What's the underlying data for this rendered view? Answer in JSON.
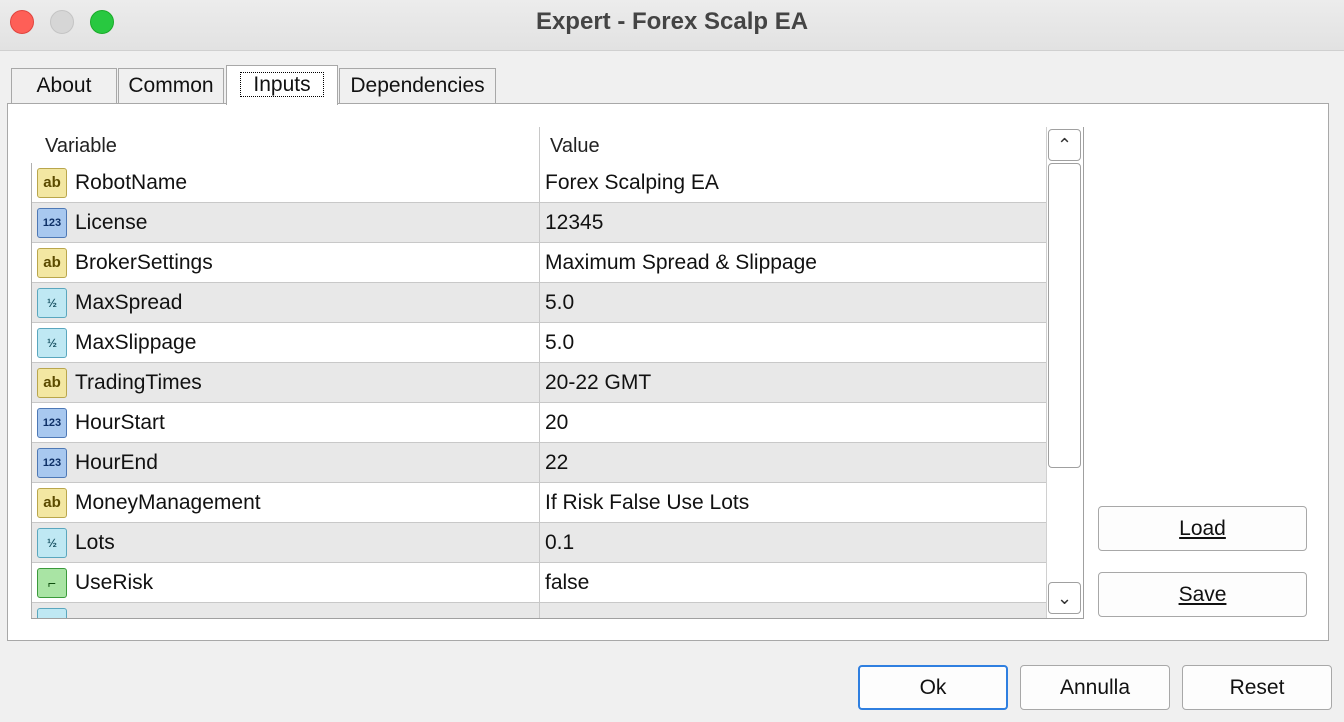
{
  "window": {
    "title": "Expert - Forex Scalp EA"
  },
  "tabs": [
    {
      "label": "About"
    },
    {
      "label": "Common"
    },
    {
      "label": "Inputs"
    },
    {
      "label": "Dependencies"
    }
  ],
  "grid": {
    "headers": {
      "variable": "Variable",
      "value": "Value"
    },
    "rows": [
      {
        "type": "string",
        "icon_text": "ab",
        "variable": "RobotName",
        "value": "Forex Scalping EA"
      },
      {
        "type": "int",
        "icon_text": "123",
        "variable": "License",
        "value": "12345"
      },
      {
        "type": "string",
        "icon_text": "ab",
        "variable": "BrokerSettings",
        "value": "Maximum Spread & Slippage"
      },
      {
        "type": "double",
        "icon_text": "½",
        "variable": "MaxSpread",
        "value": "5.0"
      },
      {
        "type": "double",
        "icon_text": "½",
        "variable": "MaxSlippage",
        "value": "5.0"
      },
      {
        "type": "string",
        "icon_text": "ab",
        "variable": "TradingTimes",
        "value": "20-22 GMT"
      },
      {
        "type": "int",
        "icon_text": "123",
        "variable": "HourStart",
        "value": "20"
      },
      {
        "type": "int",
        "icon_text": "123",
        "variable": "HourEnd",
        "value": "22"
      },
      {
        "type": "string",
        "icon_text": "ab",
        "variable": "MoneyManagement",
        "value": "If Risk False Use Lots"
      },
      {
        "type": "double",
        "icon_text": "½",
        "variable": "Lots",
        "value": "0.1"
      },
      {
        "type": "bool",
        "icon_text": "⌐",
        "variable": "UseRisk",
        "value": "false"
      },
      {
        "type": "double",
        "icon_text": "½",
        "variable": "",
        "value": ""
      }
    ]
  },
  "side_buttons": {
    "load": "Load",
    "save": "Save"
  },
  "footer_buttons": {
    "ok": "Ok",
    "cancel": "Annulla",
    "reset": "Reset"
  },
  "colors": {
    "default_button_border": "#2f7fe0",
    "alt_row": "#e8e8e8"
  }
}
